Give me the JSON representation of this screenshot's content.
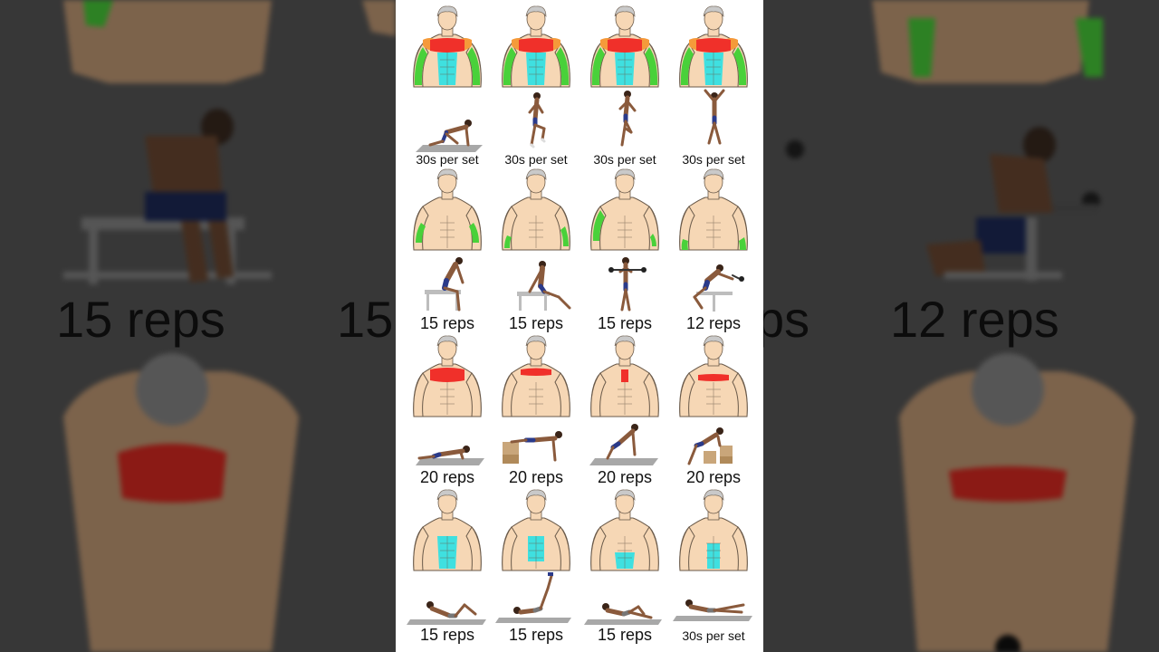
{
  "left_panel": {
    "label": "15 reps"
  },
  "right_panel": {
    "label": "12 reps",
    "partial_label": "ps"
  },
  "left_partial_label": "15",
  "sections": [
    {
      "muscle_group": "shoulders-chest-arms-abs",
      "highlight_colors": [
        "#f0302a",
        "#f59a3a",
        "#49d13a",
        "#3fe0e0"
      ],
      "exercises": [
        {
          "pose": "mountain-climber",
          "caption": "30s per set"
        },
        {
          "pose": "high-knees",
          "caption": "30s per set"
        },
        {
          "pose": "butt-kicks",
          "caption": "30s per set"
        },
        {
          "pose": "jumping-jack",
          "caption": "30s per set"
        }
      ]
    },
    {
      "muscle_group": "arms",
      "highlight_colors": [
        "#49d13a"
      ],
      "exercises": [
        {
          "pose": "bench-dip-seated",
          "caption": "15 reps"
        },
        {
          "pose": "bench-dip",
          "caption": "15 reps"
        },
        {
          "pose": "standing-curl",
          "caption": "15 reps"
        },
        {
          "pose": "kneeling-curl",
          "caption": "12 reps"
        }
      ]
    },
    {
      "muscle_group": "chest",
      "highlight_colors": [
        "#f0302a"
      ],
      "exercises": [
        {
          "pose": "push-up",
          "caption": "20 reps"
        },
        {
          "pose": "decline-push-up",
          "caption": "20 reps"
        },
        {
          "pose": "knee-push-up",
          "caption": "20 reps"
        },
        {
          "pose": "incline-push-up",
          "caption": "20 reps"
        }
      ]
    },
    {
      "muscle_group": "abs",
      "highlight_colors": [
        "#3fe0e0"
      ],
      "exercises": [
        {
          "pose": "crunch",
          "caption": "15 reps"
        },
        {
          "pose": "leg-raise",
          "caption": "15 reps"
        },
        {
          "pose": "bicycle-crunch",
          "caption": "15 reps"
        },
        {
          "pose": "flutter-kicks",
          "caption": "30s per set"
        }
      ]
    }
  ]
}
